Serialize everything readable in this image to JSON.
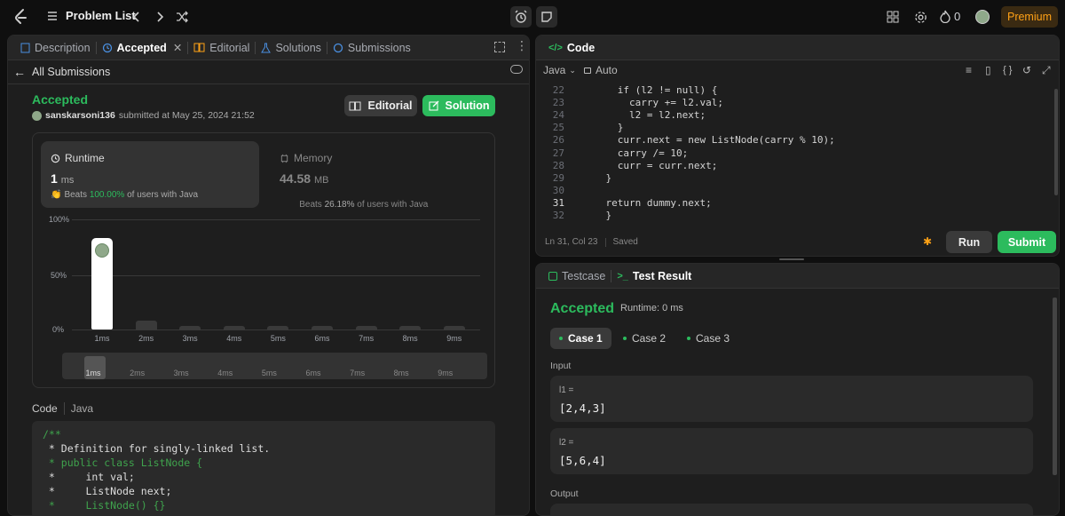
{
  "topbar": {
    "title": "Problem List",
    "streak": "0",
    "premium": "Premium",
    "icons": [
      "list-icon",
      "prev-icon",
      "next-icon",
      "shuffle-icon",
      "alarm-icon",
      "note-icon",
      "grid-icon",
      "settings-icon",
      "fire-icon",
      "avatar"
    ]
  },
  "left": {
    "tabs": [
      "Description",
      "Accepted",
      "Editorial",
      "Solutions",
      "Submissions"
    ],
    "back_label": "All Submissions",
    "status": "Accepted",
    "user": "sanskarsoni136",
    "submitted": "submitted at May 25, 2024 21:52",
    "editorial_btn": "Editorial",
    "solution_btn": "Solution",
    "runtime": {
      "label": "Runtime",
      "value": "1",
      "unit": "ms",
      "beats_pre": "Beats ",
      "beats_pct": "100.00%",
      "beats_post": " of users with Java"
    },
    "memory": {
      "label": "Memory",
      "value": "44.58",
      "unit": "MB",
      "beats_pre": "Beats ",
      "beats_pct": "26.18%",
      "beats_post": " of users with Java"
    },
    "code_label": "Code",
    "lang_label": "Java",
    "code_lines": [
      "/**",
      " * Definition for singly-linked list.",
      " * public class ListNode {",
      " *     int val;",
      " *     ListNode next;",
      " *     ListNode() {}"
    ]
  },
  "chart_data": {
    "type": "bar",
    "categories": [
      "1ms",
      "2ms",
      "3ms",
      "4ms",
      "5ms",
      "6ms",
      "7ms",
      "8ms",
      "9ms"
    ],
    "values": [
      83,
      8,
      2,
      2,
      2,
      2,
      2,
      2,
      2
    ],
    "y_ticks": [
      "100%",
      "50%",
      "0%"
    ],
    "ylim": [
      0,
      100
    ],
    "highlight_index": 0,
    "colors": {
      "highlight": "#ffffff",
      "bar": "#3a3a3a"
    }
  },
  "editor": {
    "title": "Code",
    "lang": "Java",
    "mode": "Auto",
    "status_pos": "Ln 31, Col 23",
    "status_saved": "Saved",
    "run": "Run",
    "submit": "Submit",
    "lines": [
      {
        "n": "22",
        "code": "      if (l2 != null) {"
      },
      {
        "n": "23",
        "code": "        carry += l2.val;"
      },
      {
        "n": "24",
        "code": "        l2 = l2.next;"
      },
      {
        "n": "25",
        "code": "      }"
      },
      {
        "n": "26",
        "code": "      curr.next = new ListNode(carry % 10);"
      },
      {
        "n": "27",
        "code": "      carry /= 10;"
      },
      {
        "n": "28",
        "code": "      curr = curr.next;"
      },
      {
        "n": "29",
        "code": "    }"
      },
      {
        "n": "30",
        "code": ""
      },
      {
        "n": "31",
        "code": "    return dummy.next;"
      },
      {
        "n": "32",
        "code": "    }"
      }
    ]
  },
  "result": {
    "tab_testcase": "Testcase",
    "tab_result": "Test Result",
    "status": "Accepted",
    "runtime": "Runtime: 0 ms",
    "cases": [
      "Case 1",
      "Case 2",
      "Case 3"
    ],
    "input_label": "Input",
    "l1_label": "l1 =",
    "l1_value": "[2,4,3]",
    "l2_label": "l2 =",
    "l2_value": "[5,6,4]",
    "output_label": "Output"
  },
  "colors": {
    "accent_green": "#2cbb5d",
    "premium": "#ffa116",
    "bg": "#1e1e1e"
  }
}
